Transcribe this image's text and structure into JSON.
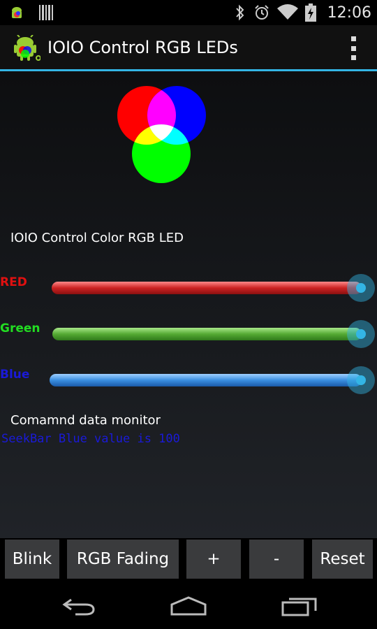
{
  "status_bar": {
    "time": "12:06",
    "icons": [
      "android-notification-icon",
      "barcode-icon",
      "bluetooth-icon",
      "alarm-icon",
      "wifi-icon",
      "battery-charging-icon"
    ]
  },
  "action_bar": {
    "title": "IOIO Control RGB LEDs",
    "icon": "app-icon",
    "overflow_icon": "overflow-menu-icon"
  },
  "main": {
    "image": "rgb-venn-image",
    "subtitle": "IOIO Control Color RGB LED",
    "sliders": [
      {
        "label": "RED",
        "color": "#e01010",
        "value_fraction": 1.0
      },
      {
        "label": "Green",
        "color": "#22dd22",
        "value_fraction": 1.0
      },
      {
        "label": "Blue",
        "color": "#1a1ad8",
        "value_fraction": 1.0
      }
    ],
    "monitor_label": "Comamnd data monitor",
    "monitor_text": "SeekBar Blue value is 100"
  },
  "buttons": [
    "Blink",
    "RGB Fading",
    "+",
    "-",
    "Reset"
  ],
  "nav": [
    "back-icon",
    "home-icon",
    "recent-apps-icon"
  ],
  "colors": {
    "accent": "#33b5e5"
  }
}
